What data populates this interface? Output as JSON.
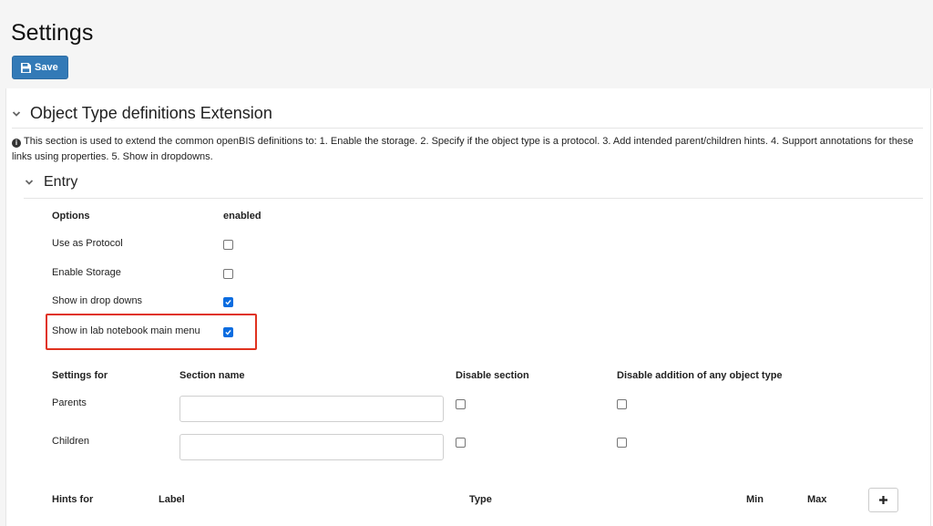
{
  "header": {
    "title": "Settings",
    "save_label": "Save"
  },
  "section": {
    "title": "Object Type definitions Extension",
    "info_text": "This section is used to extend the common openBIS definitions to: 1. Enable the storage. 2. Specify if the object type is a protocol. 3. Add intended parent/children hints. 4. Support annotations for these links using properties. 5. Show in dropdowns."
  },
  "entry": {
    "title": "Entry",
    "options_header": "Options",
    "enabled_header": "enabled",
    "options": [
      {
        "label": "Use as Protocol",
        "checked": false
      },
      {
        "label": "Enable Storage",
        "checked": false
      },
      {
        "label": "Show in drop downs",
        "checked": true
      },
      {
        "label": "Show in lab notebook main menu",
        "checked": true
      }
    ]
  },
  "settings_table": {
    "headers": [
      "Settings for",
      "Section name",
      "Disable section",
      "Disable addition of any object type"
    ],
    "rows": [
      {
        "label": "Parents",
        "section_name": "",
        "disable_section": false,
        "disable_addition": false
      },
      {
        "label": "Children",
        "section_name": "",
        "disable_section": false,
        "disable_addition": false
      }
    ]
  },
  "hints_table": {
    "headers": [
      "Hints for",
      "Label",
      "Type",
      "Min",
      "Max"
    ],
    "add_icon": "plus-icon"
  },
  "colors": {
    "primary": "#337ab7",
    "checkbox_checked": "#0a6ce0",
    "highlight": "#e0321f"
  }
}
